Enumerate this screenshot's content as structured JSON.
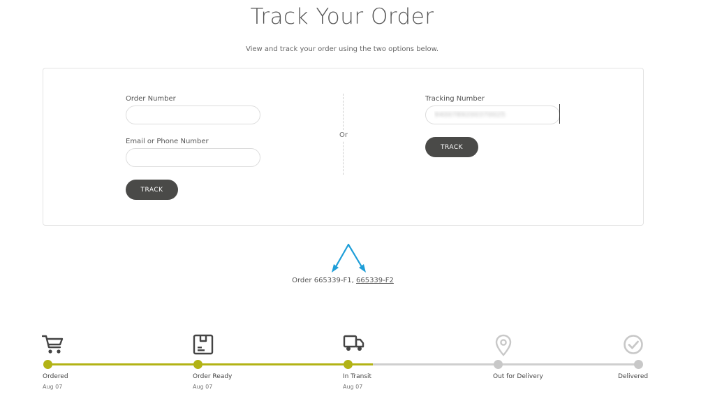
{
  "page": {
    "title": "Track Your Order",
    "subtitle": "View and track your order using the two options below."
  },
  "order_form": {
    "order_number_label": "Order Number",
    "order_number_value": "",
    "email_label": "Email or Phone Number",
    "email_value": "",
    "track_button": "TRACK"
  },
  "separator": {
    "label": "Or"
  },
  "tracking_form": {
    "tracking_number_label": "Tracking Number",
    "tracking_number_value": "9400789200370025",
    "track_button": "TRACK"
  },
  "orders": {
    "prefix": "Order",
    "first": "665339-F1",
    "separator": ",",
    "second": "665339-F2"
  },
  "colors": {
    "accent_active": "#b2b315",
    "inactive": "#c8c8c8",
    "button": "#4a4a48",
    "annotation_arrow": "#1e9ed8"
  },
  "progress_steps": [
    {
      "label": "Ordered",
      "date": "Aug 07",
      "icon": "cart-icon",
      "status": "complete"
    },
    {
      "label": "Order Ready",
      "date": "Aug 07",
      "icon": "package-icon",
      "status": "complete"
    },
    {
      "label": "In Transit",
      "date": "Aug 07",
      "icon": "truck-icon",
      "status": "complete"
    },
    {
      "label": "Out for Delivery",
      "date": "",
      "icon": "location-pin-icon",
      "status": "pending"
    },
    {
      "label": "Delivered",
      "date": "",
      "icon": "check-circle-icon",
      "status": "pending"
    }
  ]
}
